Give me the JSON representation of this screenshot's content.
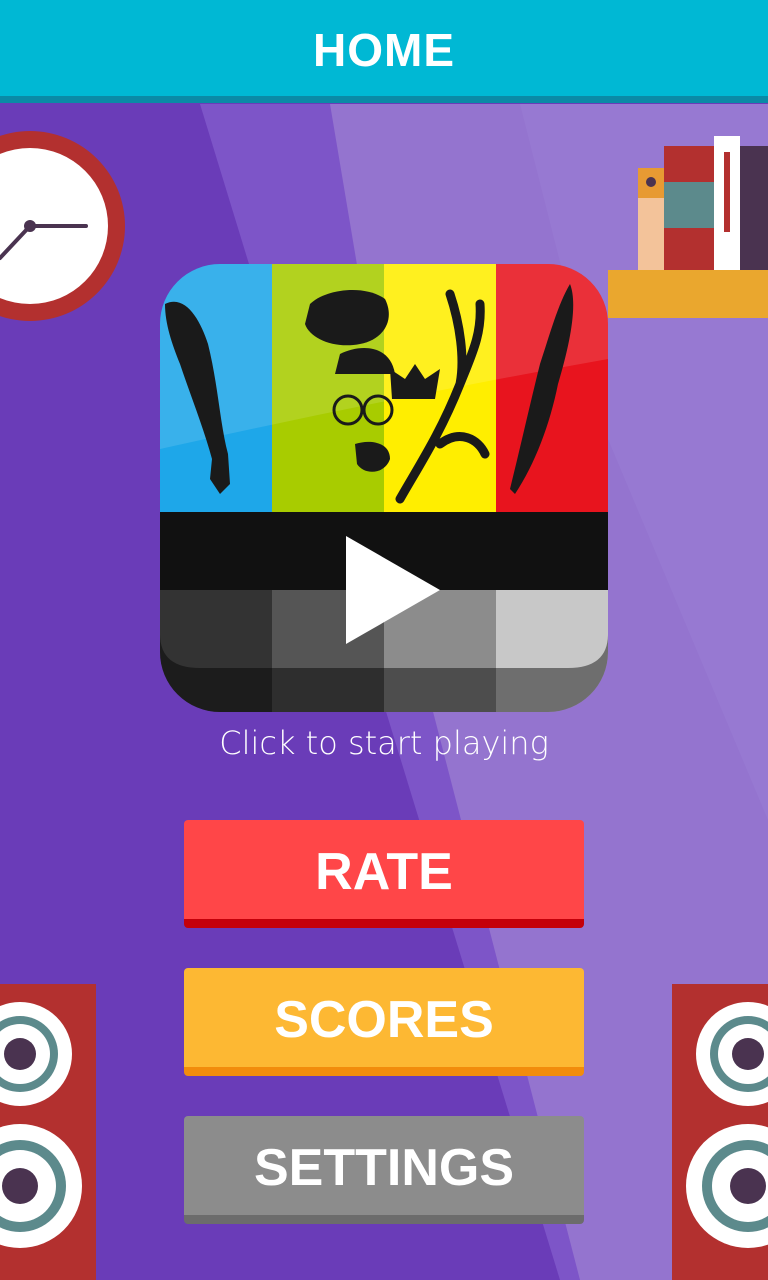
{
  "header": {
    "title": "HOME"
  },
  "play": {
    "label": "Click to start playing"
  },
  "buttons": {
    "rate": "RATE",
    "scores": "SCORES",
    "settings": "SETTINGS"
  },
  "colors": {
    "header": "#00b8d4",
    "background": "#6a3cb8",
    "rate": "#ff4648",
    "scores": "#fdb833",
    "settings": "#8c8c8c"
  },
  "icons": [
    "clock-icon",
    "bookshelf-icon",
    "speaker-icon",
    "play-icon"
  ]
}
